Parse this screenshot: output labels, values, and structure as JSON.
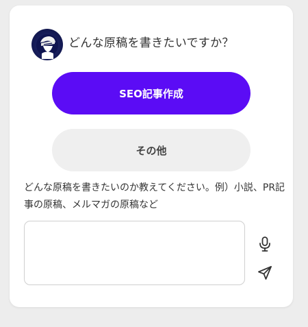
{
  "prompt": {
    "question": "どんな原稿を書きたいですか？",
    "avatar_icon": "writer-avatar-icon"
  },
  "options": {
    "primary_label": "SEO記事作成",
    "secondary_label": "その他",
    "primary_color": "#5b0cf5",
    "secondary_color": "#efefef"
  },
  "instruction_text": "どんな原稿を書きたいのか教えてください。例）小説、PR記事の原稿、メルマガの原稿など",
  "input": {
    "value": "",
    "placeholder": ""
  },
  "actions": {
    "mic_icon": "microphone-icon",
    "send_icon": "send-icon"
  }
}
